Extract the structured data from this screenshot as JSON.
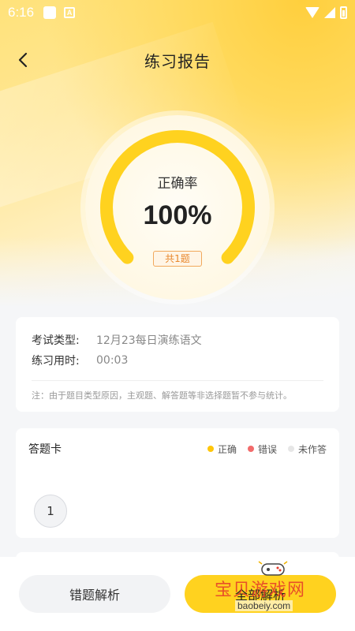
{
  "status_bar": {
    "time": "6:16",
    "app_icon_letter": "A"
  },
  "header": {
    "title": "练习报告",
    "back_icon": "chevron-left-icon"
  },
  "gauge": {
    "label": "正确率",
    "value": "100%",
    "fraction": 1.0,
    "badge": "共1题",
    "arc_color": "#ffd21f"
  },
  "info": {
    "rows": [
      {
        "key": "考试类型:",
        "value": "12月23每日演练语文"
      },
      {
        "key": "练习用时:",
        "value": "00:03"
      }
    ],
    "note": "注：由于题目类型原因，主观题、解答题等非选择题暂不参与统计。"
  },
  "answer_sheet": {
    "title": "答题卡",
    "legend": [
      {
        "label": "正确",
        "color": "#ffc60a"
      },
      {
        "label": "错误",
        "color": "#f26b6b"
      },
      {
        "label": "未作答",
        "color": "#e6e6e6"
      }
    ],
    "questions": [
      {
        "number": "1",
        "state": "correct"
      }
    ]
  },
  "actions": {
    "wrong_analysis": "错题解析",
    "all_analysis": "全部解析"
  },
  "watermark": {
    "text": "宝贝游戏网",
    "url": "baobeiy.com"
  }
}
